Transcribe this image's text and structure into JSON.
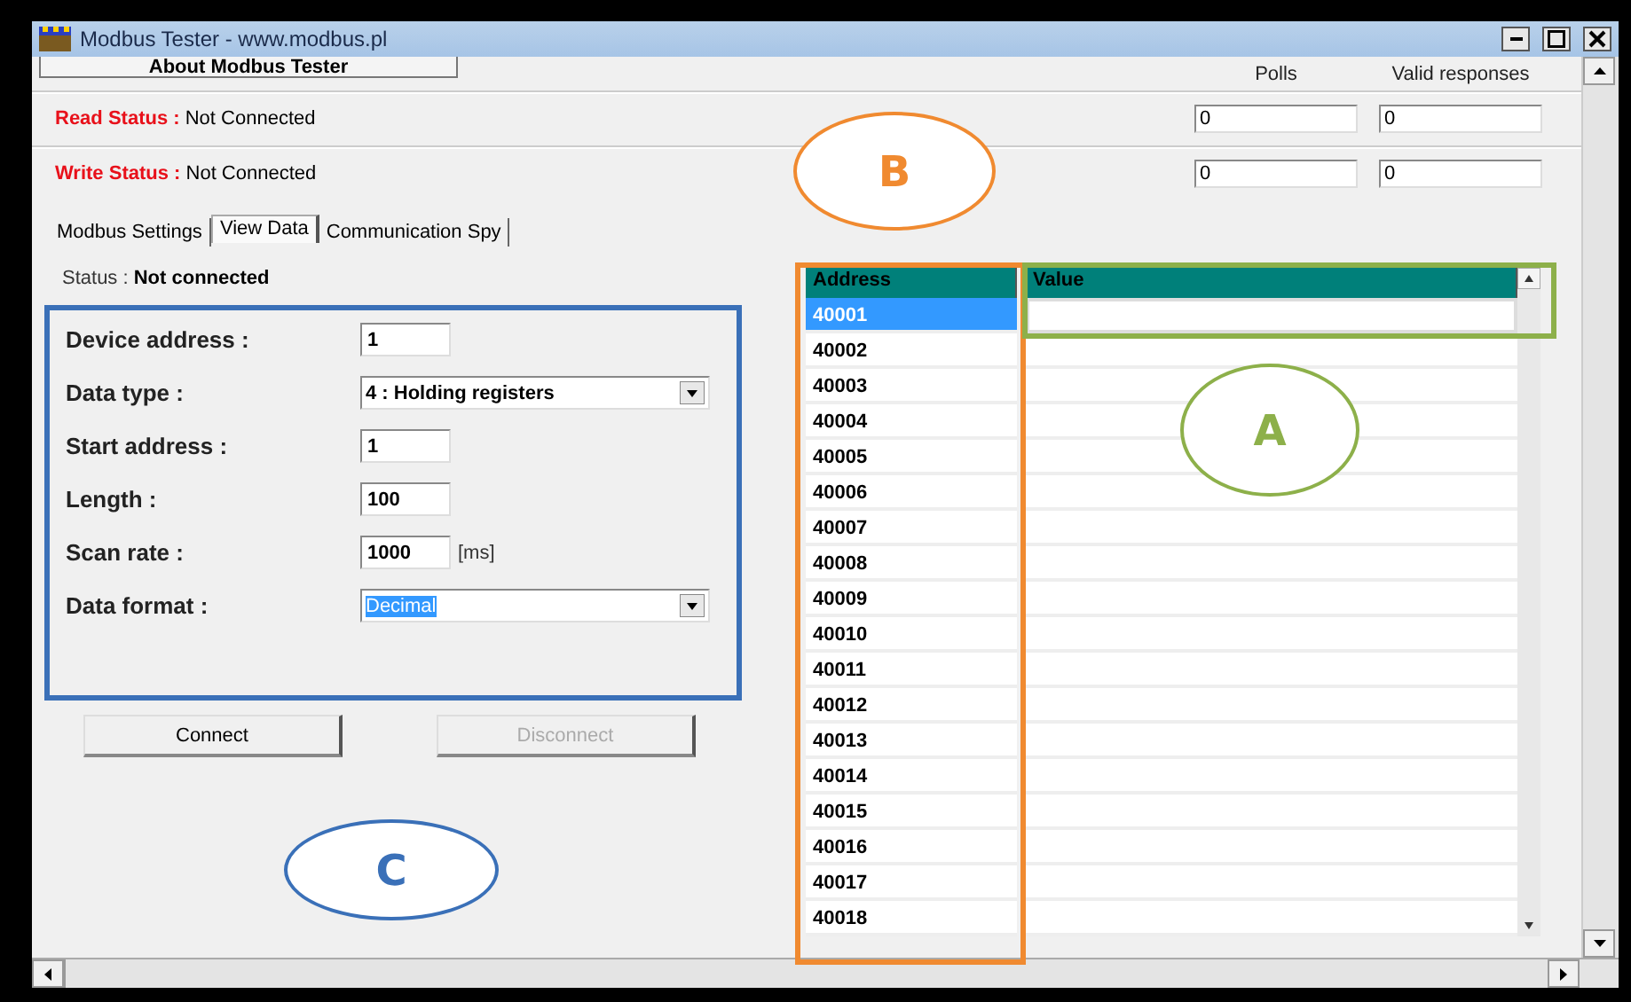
{
  "window": {
    "title": "Modbus Tester - www.modbus.pl"
  },
  "about_button": "About Modbus Tester",
  "counters": {
    "columns": [
      "Polls",
      "Valid responses"
    ]
  },
  "status_rows": [
    {
      "label": "Read Status :",
      "value": "Not Connected",
      "polls": "0",
      "valid_responses": "0"
    },
    {
      "label": "Write Status :",
      "value": "Not Connected",
      "polls": "0",
      "valid_responses": "0"
    }
  ],
  "tabs": [
    {
      "label": "Modbus Settings",
      "selected": false
    },
    {
      "label": "View Data",
      "selected": true
    },
    {
      "label": "Communication Spy",
      "selected": false
    }
  ],
  "connection_status": {
    "label": "Status :",
    "value": "Not connected"
  },
  "settings": [
    {
      "kind": "input",
      "label": "Device address :",
      "value": "1"
    },
    {
      "kind": "select",
      "label": "Data type :",
      "value": "4 : Holding registers",
      "highlighted": false
    },
    {
      "kind": "input",
      "label": "Start address :",
      "value": "1"
    },
    {
      "kind": "input",
      "label": "Length :",
      "value": "100"
    },
    {
      "kind": "input",
      "label": "Scan rate :",
      "value": "1000",
      "unit": "[ms]"
    },
    {
      "kind": "select",
      "label": "Data format :",
      "value": "Decimal",
      "highlighted": true
    }
  ],
  "buttons": [
    {
      "label": "Connect",
      "disabled": false
    },
    {
      "label": "Disconnect",
      "disabled": true
    }
  ],
  "table": {
    "columns": [
      "Address",
      "Value"
    ],
    "rows": [
      {
        "address": "40001",
        "selected": true
      },
      {
        "address": "40002",
        "selected": false
      },
      {
        "address": "40003",
        "selected": false
      },
      {
        "address": "40004",
        "selected": false
      },
      {
        "address": "40005",
        "selected": false
      },
      {
        "address": "40006",
        "selected": false
      },
      {
        "address": "40007",
        "selected": false
      },
      {
        "address": "40008",
        "selected": false
      },
      {
        "address": "40009",
        "selected": false
      },
      {
        "address": "40010",
        "selected": false
      },
      {
        "address": "40011",
        "selected": false
      },
      {
        "address": "40012",
        "selected": false
      },
      {
        "address": "40013",
        "selected": false
      },
      {
        "address": "40014",
        "selected": false
      },
      {
        "address": "40015",
        "selected": false
      },
      {
        "address": "40016",
        "selected": false
      },
      {
        "address": "40017",
        "selected": false
      },
      {
        "address": "40018",
        "selected": false
      }
    ]
  },
  "annotations": [
    {
      "label": "A",
      "color": "#8db04a"
    },
    {
      "label": "B",
      "color": "#f08a30"
    },
    {
      "label": "C",
      "color": "#3a70b8"
    }
  ]
}
